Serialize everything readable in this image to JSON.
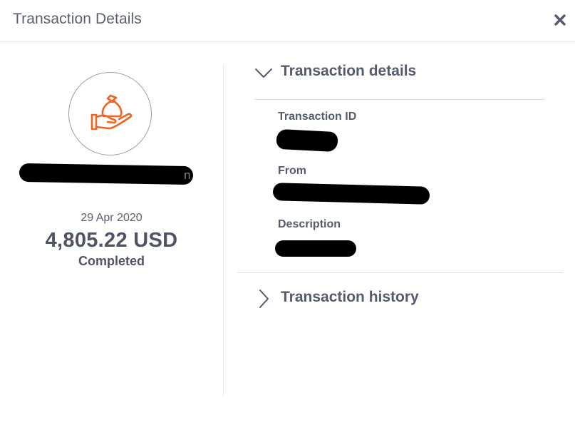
{
  "header": {
    "title": "Transaction Details",
    "close_icon": "close-icon"
  },
  "summary": {
    "icon": "money-bag-hand-icon",
    "icon_color": "#f06321",
    "name_tail": "n",
    "date": "29 Apr 2020",
    "amount": "4,805.22 USD",
    "status": "Completed"
  },
  "details": {
    "title": "Transaction details",
    "expanded": true,
    "fields": [
      {
        "label": "Transaction ID"
      },
      {
        "label": "From"
      },
      {
        "label": "Description"
      }
    ]
  },
  "history": {
    "title": "Transaction history",
    "expanded": false
  }
}
